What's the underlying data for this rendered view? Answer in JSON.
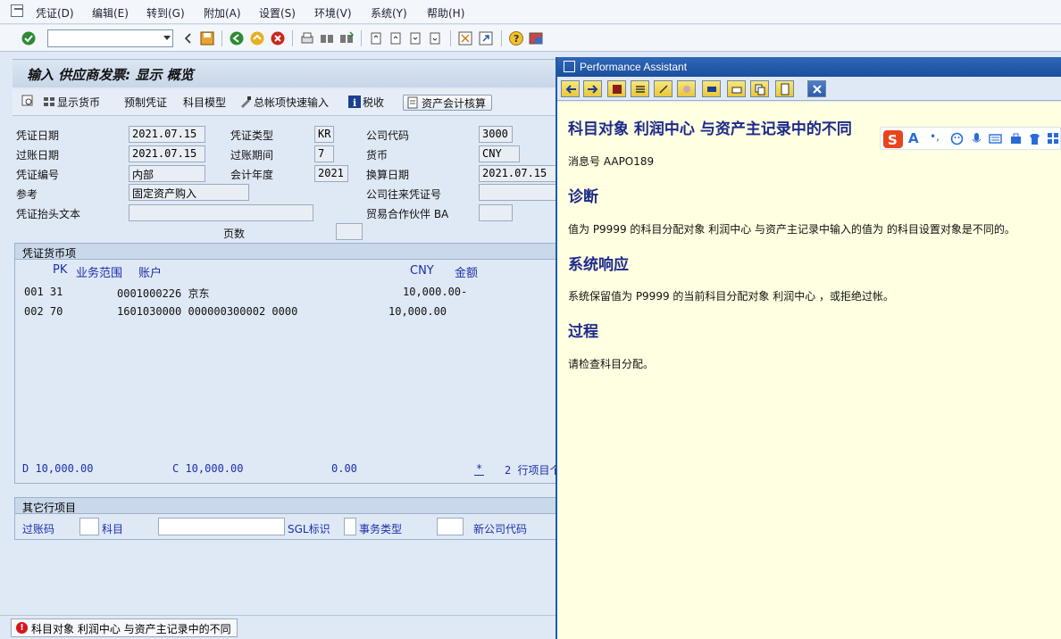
{
  "menu": {
    "items": [
      "凭证(D)",
      "编辑(E)",
      "转到(G)",
      "附加(A)",
      "设置(S)",
      "环境(V)",
      "系统(Y)",
      "帮助(H)"
    ]
  },
  "toolbar": {
    "command_value": ""
  },
  "screen": {
    "title": "输入 供应商发票: 显示 概览"
  },
  "app_toolbar": {
    "show_currency": "显示货币",
    "park_doc": "预制凭证",
    "acct_model": "科目模型",
    "fast_entry": "总帐项快速输入",
    "tax": "税收",
    "asset_acct": "资产会计核算"
  },
  "header": {
    "doc_date_label": "凭证日期",
    "doc_date": "2021.07.15",
    "doc_type_label": "凭证类型",
    "doc_type": "KR",
    "company_label": "公司代码",
    "company": "3000",
    "post_date_label": "过账日期",
    "post_date": "2021.07.15",
    "period_label": "过账期间",
    "period": "7",
    "currency_label": "货币",
    "currency": "CNY",
    "doc_no_label": "凭证编号",
    "doc_no": "内部",
    "fiscal_year_label": "会计年度",
    "fiscal_year": "2021",
    "trans_date_label": "换算日期",
    "trans_date": "2021.07.15",
    "ref_label": "参考",
    "ref": "固定资产购入",
    "intercompany_label": "公司往来凭证号",
    "header_text_label": "凭证抬头文本",
    "trading_partner_label": "贸易合作伙伴 BA",
    "pages_label": "页数"
  },
  "items": {
    "group_title": "凭证货币项",
    "col_pk": "PK",
    "col_ba": "业务范围",
    "col_acct": "账户",
    "col_cny": "CNY",
    "col_amount": "金额",
    "rows": [
      {
        "text": "001 31",
        "account": "0001000226 京东",
        "amount": "10,000.00-"
      },
      {
        "text": "002 70",
        "account": "1601030000 000000300002 0000",
        "amount": "10,000.00"
      }
    ],
    "debit": "D 10,000.00",
    "credit": "C 10,000.00",
    "balance": "0.00",
    "star": "*",
    "count": "2 行项目个"
  },
  "other_items": {
    "group_title": "其它行项目",
    "posting_key": "过账码",
    "account": "科目",
    "sgl": "SGL标识",
    "trans_type": "事务类型",
    "new_company": "新公司代码"
  },
  "status": {
    "message": "科目对象 利润中心 与资产主记录中的不同"
  },
  "pa": {
    "window_title": "Performance Assistant",
    "heading": "科目对象 利润中心 与资产主记录中的不同",
    "msg_no": "消息号 AAPO189",
    "diag_title": "诊断",
    "diag_text": "值为 P9999 的科目分配对象 利润中心 与资产主记录中输入的值为 的科目设置对象是不同的。",
    "sys_title": "系统响应",
    "sys_text": "系统保留值为 P9999 的当前科目分配对象 利润中心 ，或拒绝过帐。",
    "proc_title": "过程",
    "proc_text": "请检查科目分配。"
  },
  "ime": {
    "letter": "A",
    "dot": "•,"
  },
  "colors": {
    "sap_blue": "#1a2fa8",
    "pa_background": "#ffffe1",
    "title_bar": "#1b4f9c",
    "error_red": "#d8141a"
  }
}
